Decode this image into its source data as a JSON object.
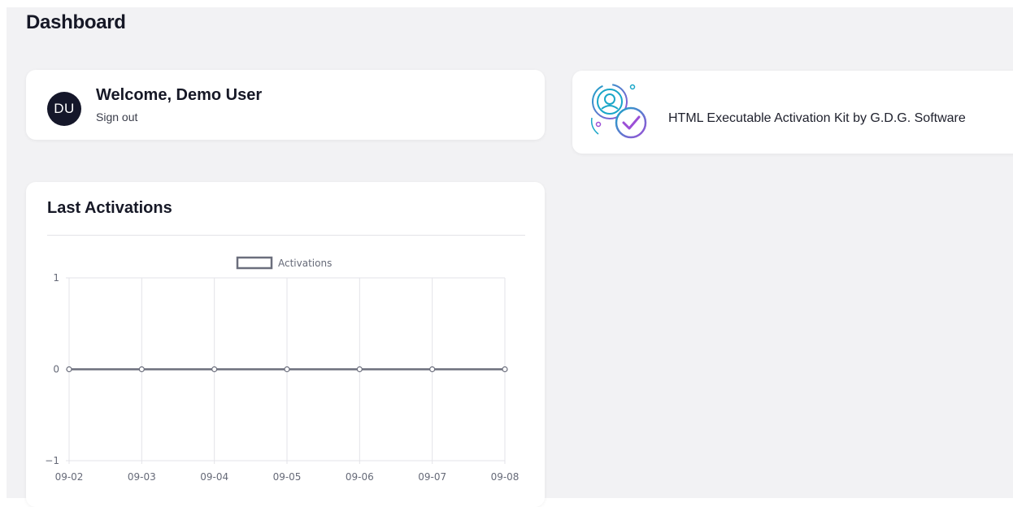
{
  "header": {
    "title": "Dashboard"
  },
  "user": {
    "initials": "DU",
    "welcome": "Welcome, Demo User",
    "signout_label": "Sign out"
  },
  "product": {
    "name": "HTML Executable Activation Kit by G.D.G. Software"
  },
  "activations_card": {
    "title": "Last Activations"
  },
  "colors": {
    "background": "#f2f2f4",
    "card": "#ffffff",
    "line": "#6b6e7c",
    "grid": "#e3e3e8",
    "avatar": "#15172a",
    "icon_teal": "#1aa6c8",
    "icon_purple": "#9b4fd6"
  },
  "chart_data": {
    "type": "line",
    "categories": [
      "09-02",
      "09-03",
      "09-04",
      "09-05",
      "09-06",
      "09-07",
      "09-08"
    ],
    "series": [
      {
        "name": "Activations",
        "values": [
          0,
          0,
          0,
          0,
          0,
          0,
          0
        ]
      }
    ],
    "y_ticks": [
      "1",
      "0",
      "−1"
    ],
    "ylim": [
      -1,
      1
    ],
    "grid": true,
    "legend_position": "top"
  }
}
